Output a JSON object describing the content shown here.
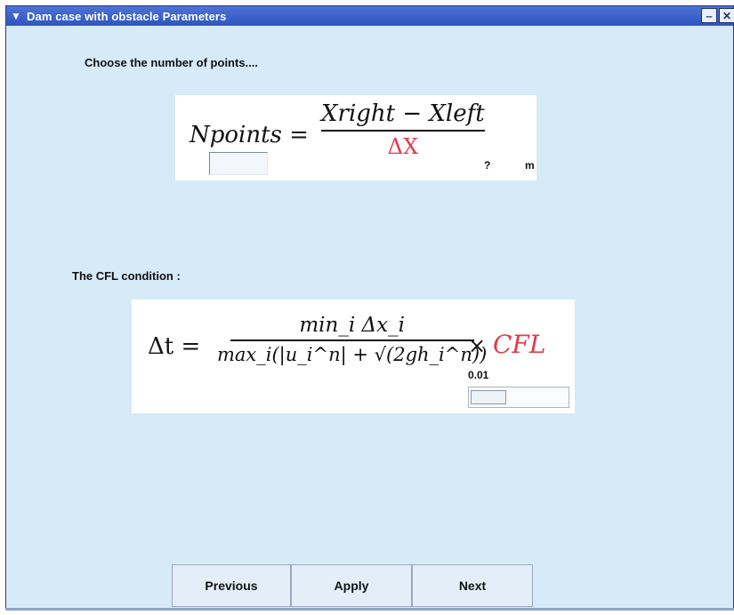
{
  "window": {
    "title": "Dam case with obstacle Parameters",
    "menu_icon": "chevron-down-icon",
    "minimize_icon": "minimize-icon",
    "close_icon": "close-icon"
  },
  "section_points": {
    "label": "Choose the number of points....",
    "formula": {
      "lhs": "Npoints =",
      "numerator": "Xright − Xleft",
      "denominator": "ΔX"
    },
    "value": "?",
    "unit": "m",
    "input_value": ""
  },
  "section_cfl": {
    "label": "The CFL condition :",
    "formula": {
      "lhs": "Δt =",
      "numerator": "min_i Δx_i",
      "denominator": "max_i(|u_i^n| + √(2gh_i^n))",
      "times": "×",
      "cfl": "CFL"
    },
    "cfl_value": "0.01",
    "slider_level": 0.0
  },
  "buttons": {
    "previous": "Previous",
    "apply": "Apply",
    "next": "Next"
  },
  "colors": {
    "window_bg": "#d6eaf8",
    "titlebar": "#2f55c0",
    "accent_red": "#e23a4a"
  }
}
